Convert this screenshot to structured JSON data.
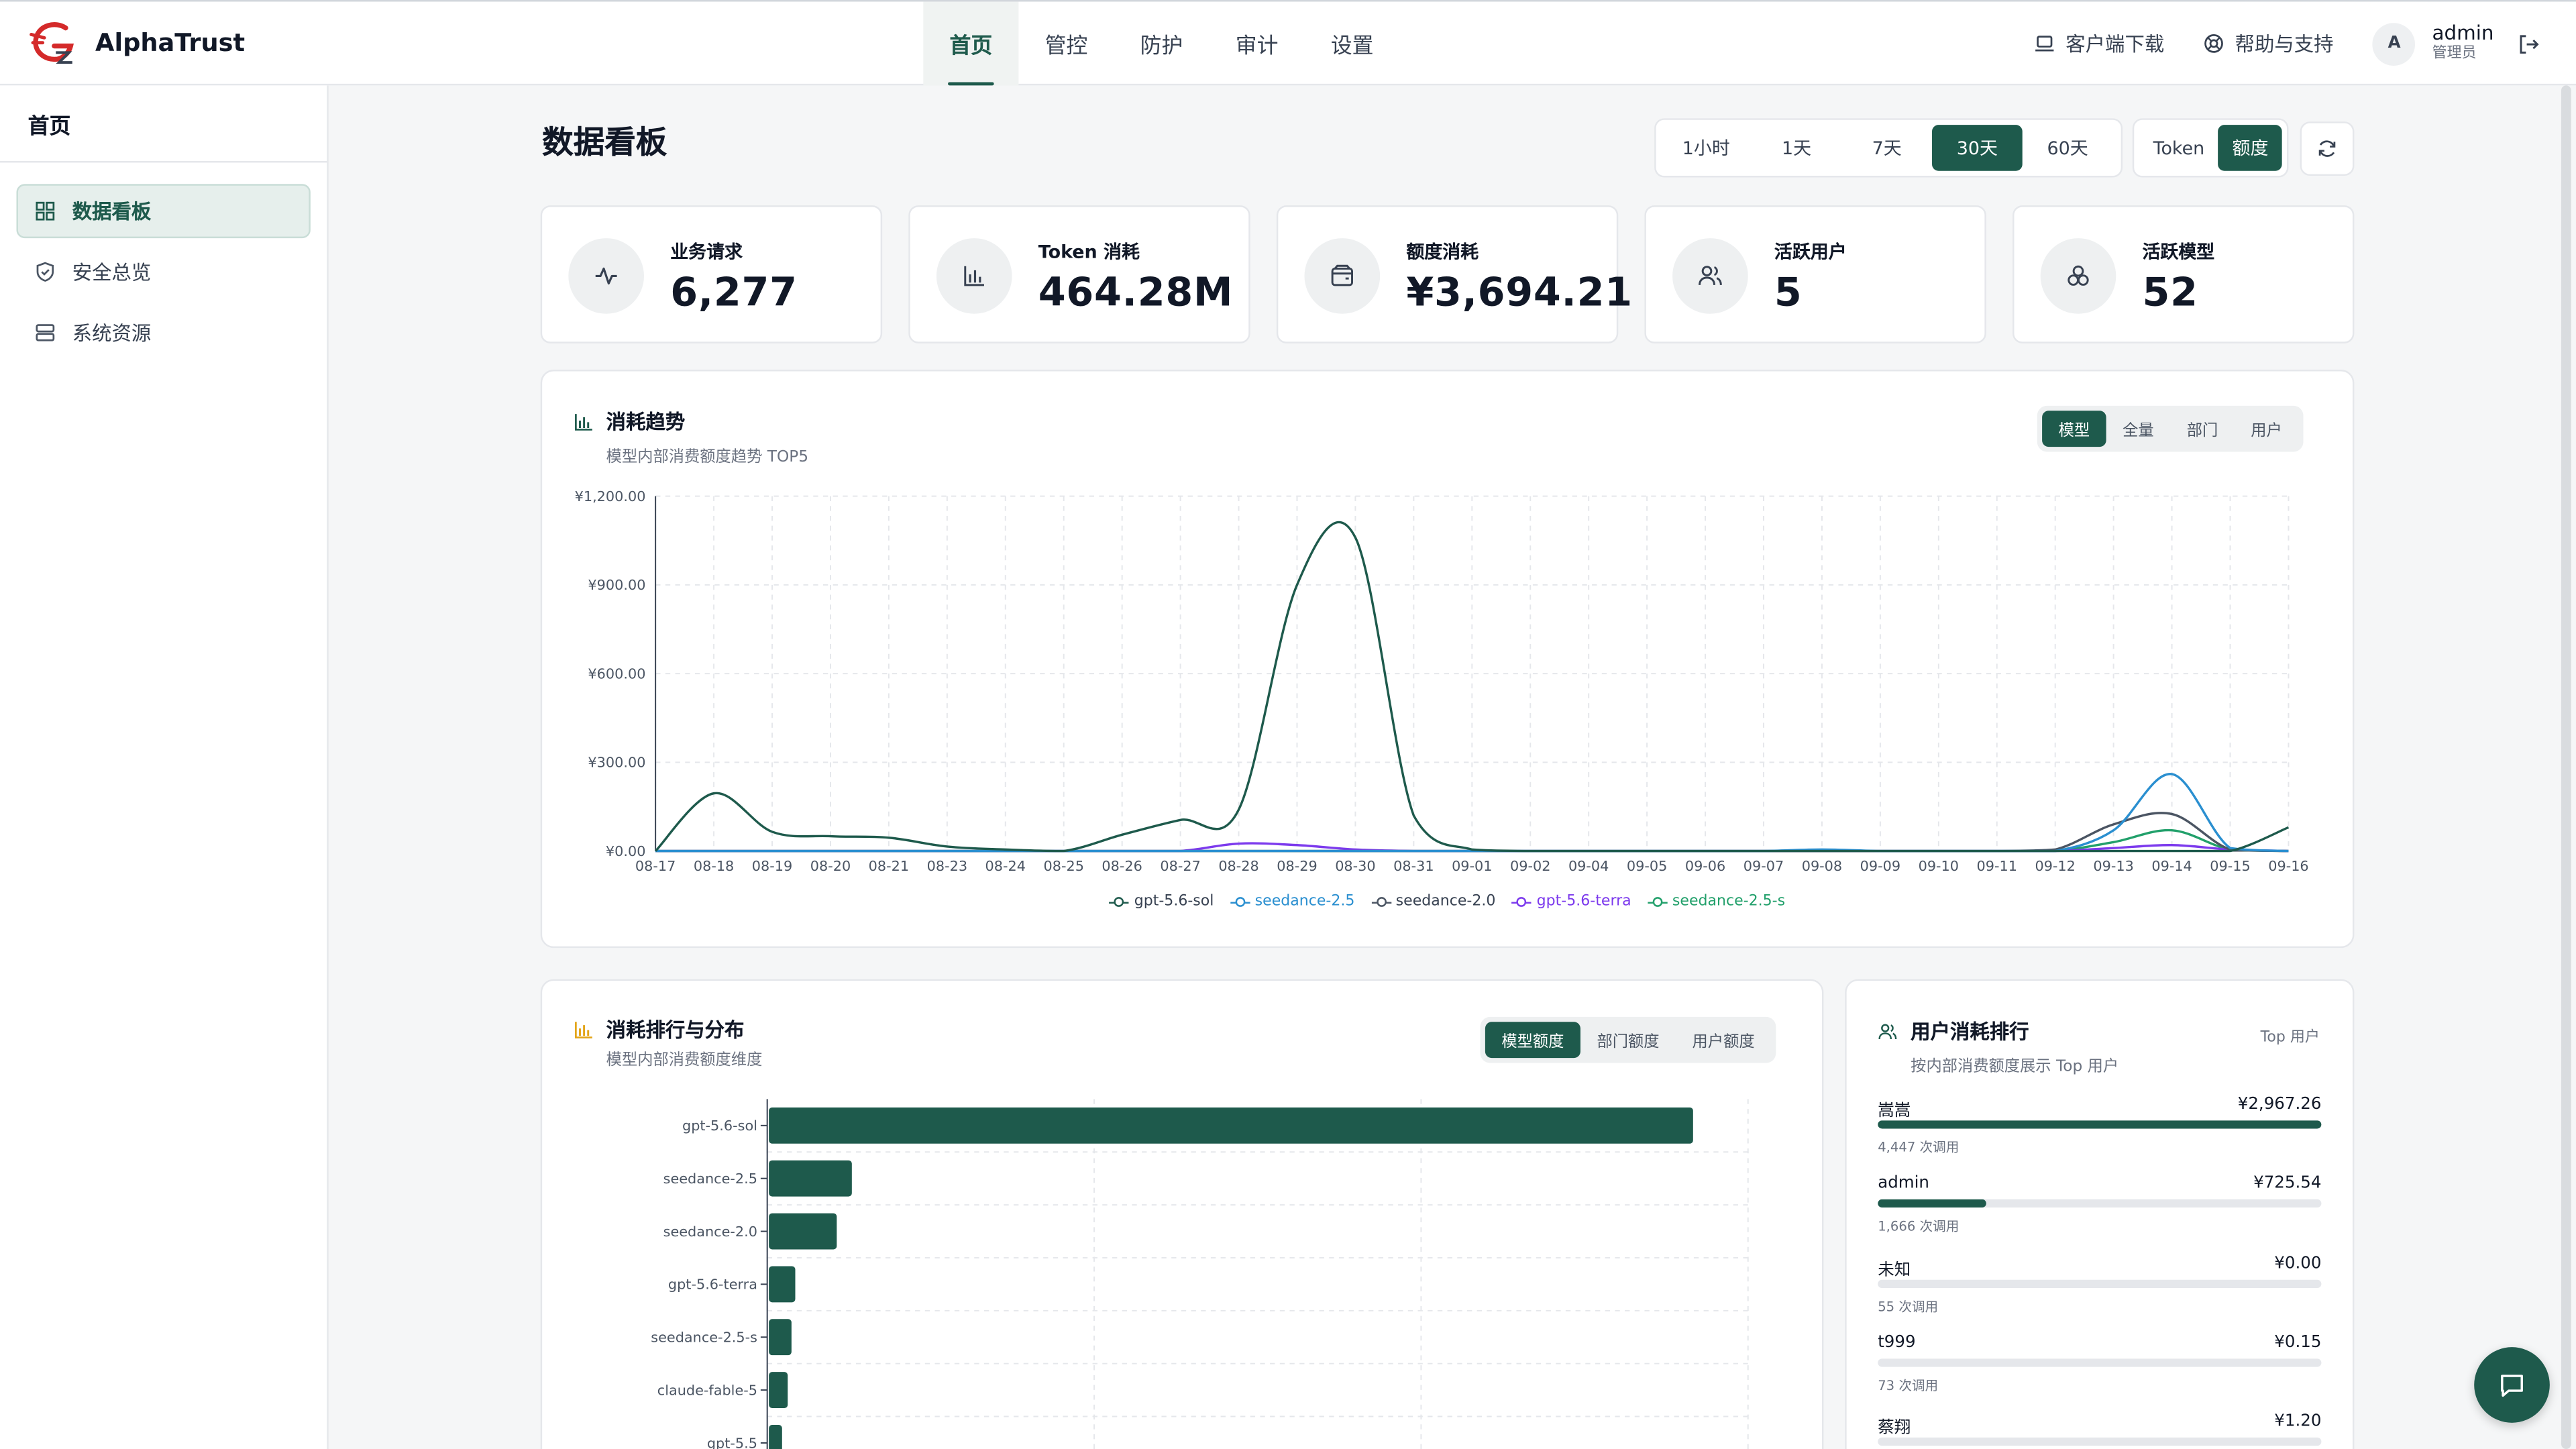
{
  "app": {
    "name": "AlphaTrust"
  },
  "nav": {
    "items": [
      "首页",
      "管控",
      "防护",
      "审计",
      "设置"
    ],
    "active_index": 0
  },
  "header_right": {
    "download": "客户端下载",
    "help": "帮助与支持",
    "avatar_letter": "A",
    "user_name": "admin",
    "user_role": "管理员"
  },
  "sidebar": {
    "title": "首页",
    "items": [
      {
        "label": "数据看板",
        "icon": "dashboard-icon",
        "active": true
      },
      {
        "label": "安全总览",
        "icon": "shield-icon",
        "active": false
      },
      {
        "label": "系统资源",
        "icon": "server-icon",
        "active": false
      }
    ]
  },
  "page": {
    "title": "数据看板"
  },
  "time_range": {
    "options": [
      "1小时",
      "1天",
      "7天",
      "30天",
      "60天"
    ],
    "selected": "30天"
  },
  "metric_toggle": {
    "options": [
      "Token",
      "额度"
    ],
    "selected": "额度"
  },
  "kpis": [
    {
      "label": "业务请求",
      "value": "6,277",
      "icon": "activity-icon"
    },
    {
      "label": "Token 消耗",
      "value": "464.28M",
      "icon": "bar-chart-icon"
    },
    {
      "label": "额度消耗",
      "value": "¥3,694.21",
      "icon": "wallet-icon"
    },
    {
      "label": "活跃用户",
      "value": "5",
      "icon": "users-icon"
    },
    {
      "label": "活跃模型",
      "value": "52",
      "icon": "cubes-icon"
    }
  ],
  "trend": {
    "title": "消耗趋势",
    "subtitle": "模型内部消费额度趋势 TOP5",
    "tabs": [
      "模型",
      "全量",
      "部门",
      "用户"
    ],
    "active_tab": "模型"
  },
  "ranking": {
    "title": "消耗排行与分布",
    "subtitle": "模型内部消费额度维度",
    "tabs": [
      "模型额度",
      "部门额度",
      "用户额度"
    ],
    "active_tab": "模型额度"
  },
  "users": {
    "title": "用户消耗排行",
    "badge": "Top 用户",
    "subtitle": "按内部消费额度展示 Top 用户",
    "rows": [
      {
        "name": "嵩嵩",
        "amount": "¥2,967.26",
        "calls": "4,447 次调用",
        "share": 1.0
      },
      {
        "name": "admin",
        "amount": "¥725.54",
        "calls": "1,666 次调用",
        "share": 0.245
      },
      {
        "name": "未知",
        "amount": "¥0.00",
        "calls": "55 次调用",
        "share": 0
      },
      {
        "name": "t999",
        "amount": "¥0.15",
        "calls": "73 次调用",
        "share": 0
      },
      {
        "name": "蔡翔",
        "amount": "¥1.20",
        "calls": "",
        "share": 0
      }
    ]
  },
  "chart_data": [
    {
      "type": "line",
      "title": "消耗趋势",
      "x": [
        "08-17",
        "08-18",
        "08-19",
        "08-20",
        "08-21",
        "08-23",
        "08-24",
        "08-25",
        "08-26",
        "08-27",
        "08-28",
        "08-29",
        "08-30",
        "08-31",
        "09-01",
        "09-02",
        "09-04",
        "09-05",
        "09-06",
        "09-07",
        "09-08",
        "09-09",
        "09-10",
        "09-11",
        "09-12",
        "09-13",
        "09-14",
        "09-15",
        "09-16"
      ],
      "yticks": [
        "¥0.00",
        "¥300.00",
        "¥600.00",
        "¥900.00",
        "¥1,200.00"
      ],
      "ylim": [
        0,
        1200
      ],
      "grid": true,
      "legend": "bottom",
      "series": [
        {
          "name": "gpt-5.6-sol",
          "color": "#1e5a4c",
          "values": [
            0,
            195,
            65,
            50,
            45,
            15,
            5,
            0,
            55,
            105,
            140,
            900,
            1060,
            120,
            5,
            0,
            0,
            0,
            0,
            0,
            0,
            0,
            0,
            0,
            0,
            0,
            0,
            0,
            80
          ]
        },
        {
          "name": "seedance-2.5",
          "color": "#2a8fd0",
          "values": [
            0,
            0,
            0,
            0,
            0,
            0,
            0,
            0,
            0,
            0,
            0,
            0,
            0,
            0,
            0,
            0,
            0,
            0,
            0,
            0,
            5,
            0,
            0,
            0,
            0,
            70,
            260,
            10,
            0
          ]
        },
        {
          "name": "seedance-2.0",
          "color": "#4b5563",
          "values": [
            0,
            0,
            0,
            0,
            0,
            0,
            0,
            0,
            0,
            0,
            0,
            0,
            0,
            0,
            0,
            0,
            0,
            0,
            0,
            0,
            0,
            0,
            0,
            0,
            5,
            90,
            125,
            5,
            0
          ]
        },
        {
          "name": "gpt-5.6-terra",
          "color": "#7c3aed",
          "values": [
            0,
            0,
            0,
            0,
            0,
            0,
            0,
            0,
            0,
            0,
            25,
            20,
            5,
            0,
            0,
            0,
            0,
            0,
            0,
            0,
            0,
            0,
            0,
            0,
            0,
            10,
            20,
            5,
            0
          ]
        },
        {
          "name": "seedance-2.5-s",
          "color": "#22a06b",
          "values": [
            0,
            0,
            0,
            0,
            0,
            0,
            0,
            0,
            0,
            0,
            0,
            0,
            0,
            0,
            0,
            0,
            0,
            0,
            0,
            0,
            0,
            0,
            0,
            0,
            0,
            30,
            70,
            5,
            0
          ]
        }
      ]
    },
    {
      "type": "bar",
      "title": "消耗排行与分布",
      "orientation": "horizontal",
      "categories": [
        "gpt-5.6-sol",
        "seedance-2.5",
        "seedance-2.0",
        "gpt-5.6-terra",
        "seedance-2.5-s",
        "claude-fable-5",
        "gpt-5.5"
      ],
      "values": [
        2450,
        220,
        180,
        70,
        60,
        50,
        35
      ],
      "xlim": [
        0,
        2600
      ],
      "grid": true,
      "color": "#1e5a4c"
    }
  ]
}
